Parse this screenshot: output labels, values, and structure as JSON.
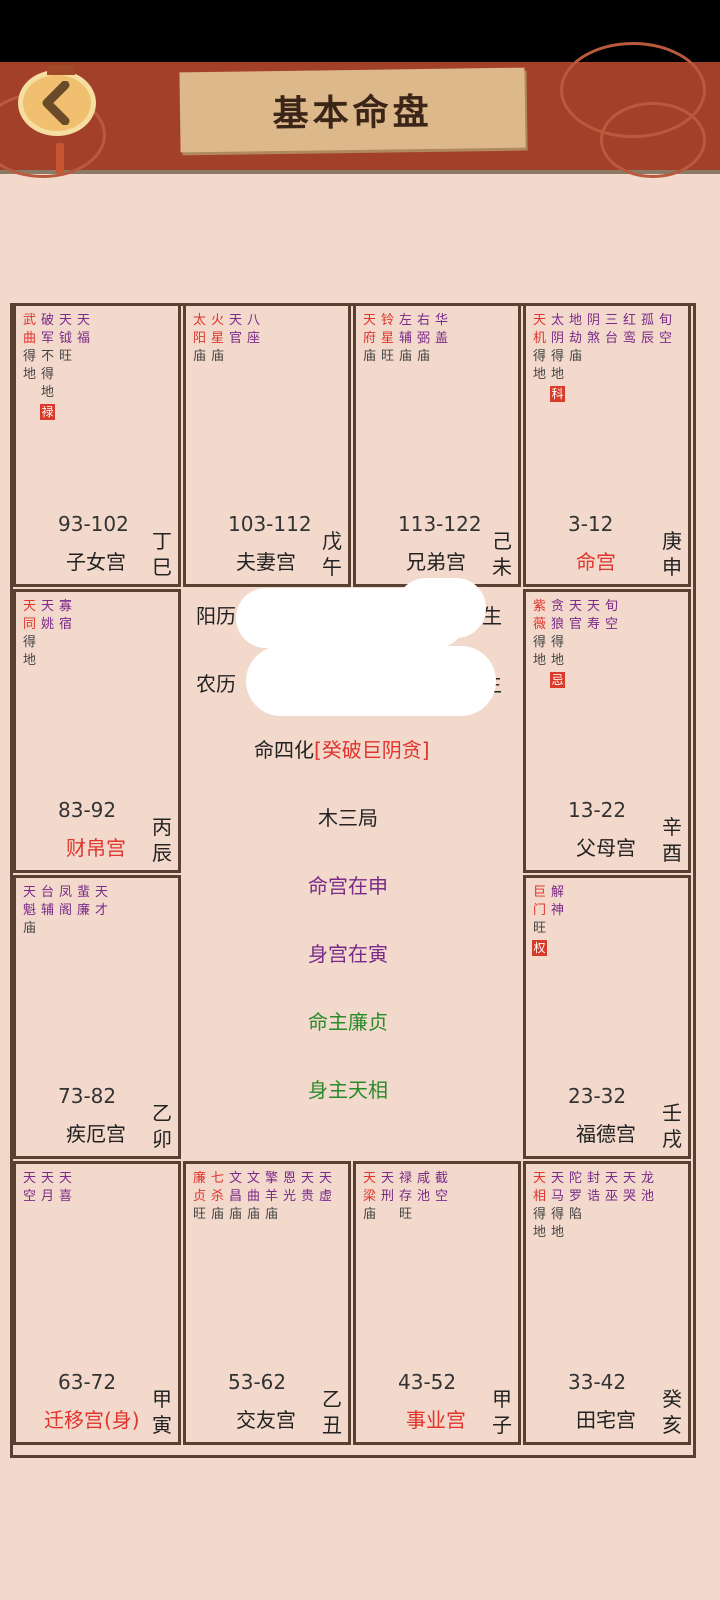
{
  "header": {
    "title": "基本命盘",
    "back_icon": "chevron-left-icon"
  },
  "palaces": [
    {
      "id": "zinv",
      "pos": [
        0,
        0
      ],
      "ages": "93-102",
      "name": "子女宫",
      "gan": "丁",
      "zhi": "巳",
      "highlight": false,
      "stars": [
        {
          "n": "武曲",
          "c": "red",
          "s": [
            "得",
            "地"
          ]
        },
        {
          "n": "破军",
          "c": "purple",
          "s": [
            "不",
            "得",
            "地"
          ],
          "hua": "禄"
        },
        {
          "n": "天钺",
          "c": "purple",
          "s": [
            "旺"
          ]
        },
        {
          "n": "天福",
          "c": "purple",
          "s": []
        }
      ]
    },
    {
      "id": "fuqi",
      "pos": [
        1,
        0
      ],
      "ages": "103-112",
      "name": "夫妻宫",
      "gan": "戊",
      "zhi": "午",
      "highlight": false,
      "stars": [
        {
          "n": "太阳",
          "c": "red",
          "s": [
            "庙"
          ]
        },
        {
          "n": "火星",
          "c": "red",
          "s": [
            "庙"
          ]
        },
        {
          "n": "天官",
          "c": "purple",
          "s": []
        },
        {
          "n": "八座",
          "c": "purple",
          "s": []
        }
      ]
    },
    {
      "id": "xiongdi",
      "pos": [
        2,
        0
      ],
      "ages": "113-122",
      "name": "兄弟宫",
      "gan": "己",
      "zhi": "未",
      "highlight": false,
      "stars": [
        {
          "n": "天府",
          "c": "red",
          "s": [
            "庙"
          ]
        },
        {
          "n": "铃星",
          "c": "red",
          "s": [
            "旺"
          ]
        },
        {
          "n": "左辅",
          "c": "purple",
          "s": [
            "庙"
          ]
        },
        {
          "n": "右弼",
          "c": "purple",
          "s": [
            "庙"
          ]
        },
        {
          "n": "华盖",
          "c": "purple",
          "s": []
        }
      ]
    },
    {
      "id": "ming",
      "pos": [
        3,
        0
      ],
      "ages": "3-12",
      "name": "命宫",
      "gan": "庚",
      "zhi": "申",
      "highlight": true,
      "stars": [
        {
          "n": "天机",
          "c": "red",
          "s": [
            "得",
            "地"
          ]
        },
        {
          "n": "太阴",
          "c": "purple",
          "s": [
            "得",
            "地"
          ],
          "hua": "科"
        },
        {
          "n": "地劫",
          "c": "purple",
          "s": [
            "庙"
          ]
        },
        {
          "n": "阴煞",
          "c": "purple",
          "s": []
        },
        {
          "n": "三台",
          "c": "purple",
          "s": []
        },
        {
          "n": "红鸾",
          "c": "purple",
          "s": []
        },
        {
          "n": "孤辰",
          "c": "purple",
          "s": []
        },
        {
          "n": "旬空",
          "c": "purple",
          "s": []
        }
      ]
    },
    {
      "id": "caibo",
      "pos": [
        0,
        1
      ],
      "ages": "83-92",
      "name": "财帛宫",
      "gan": "丙",
      "zhi": "辰",
      "highlight": true,
      "stars": [
        {
          "n": "天同",
          "c": "red",
          "s": [
            "得",
            "地"
          ]
        },
        {
          "n": "天姚",
          "c": "purple",
          "s": []
        },
        {
          "n": "寡宿",
          "c": "purple",
          "s": []
        }
      ]
    },
    {
      "id": "fumu",
      "pos": [
        3,
        1
      ],
      "ages": "13-22",
      "name": "父母宫",
      "gan": "辛",
      "zhi": "酉",
      "highlight": false,
      "stars": [
        {
          "n": "紫薇",
          "c": "red",
          "s": [
            "得",
            "地"
          ]
        },
        {
          "n": "贪狼",
          "c": "purple",
          "s": [
            "得",
            "地"
          ],
          "hua": "忌"
        },
        {
          "n": "天官",
          "c": "purple",
          "s": []
        },
        {
          "n": "天寿",
          "c": "purple",
          "s": []
        },
        {
          "n": "旬空",
          "c": "purple",
          "s": []
        }
      ]
    },
    {
      "id": "jie",
      "pos": [
        0,
        2
      ],
      "ages": "73-82",
      "name": "疾厄宫",
      "gan": "乙",
      "zhi": "卯",
      "highlight": false,
      "stars": [
        {
          "n": "天魁",
          "c": "purple",
          "s": [
            "庙"
          ]
        },
        {
          "n": "台辅",
          "c": "purple",
          "s": []
        },
        {
          "n": "凤阁",
          "c": "purple",
          "s": []
        },
        {
          "n": "蜚廉",
          "c": "purple",
          "s": []
        },
        {
          "n": "天才",
          "c": "purple",
          "s": []
        }
      ]
    },
    {
      "id": "fude",
      "pos": [
        3,
        2
      ],
      "ages": "23-32",
      "name": "福德宫",
      "gan": "壬",
      "zhi": "戌",
      "highlight": false,
      "stars": [
        {
          "n": "巨门",
          "c": "red",
          "s": [
            "旺"
          ],
          "hua": "权"
        },
        {
          "n": "解神",
          "c": "purple",
          "s": []
        }
      ]
    },
    {
      "id": "qianyi",
      "pos": [
        0,
        3
      ],
      "ages": "63-72",
      "name": "迁移宫(身)",
      "gan": "甲",
      "zhi": "寅",
      "highlight": true,
      "stars": [
        {
          "n": "天空",
          "c": "purple",
          "s": []
        },
        {
          "n": "天月",
          "c": "purple",
          "s": []
        },
        {
          "n": "天喜",
          "c": "purple",
          "s": []
        }
      ]
    },
    {
      "id": "jiaoyou",
      "pos": [
        1,
        3
      ],
      "ages": "53-62",
      "name": "交友宫",
      "gan": "乙",
      "zhi": "丑",
      "highlight": false,
      "stars": [
        {
          "n": "廉贞",
          "c": "red",
          "s": [
            "旺"
          ]
        },
        {
          "n": "七杀",
          "c": "red",
          "s": [
            "庙"
          ]
        },
        {
          "n": "文昌",
          "c": "purple",
          "s": [
            "庙"
          ]
        },
        {
          "n": "文曲",
          "c": "purple",
          "s": [
            "庙"
          ]
        },
        {
          "n": "擎羊",
          "c": "purple",
          "s": [
            "庙"
          ]
        },
        {
          "n": "恩光",
          "c": "purple",
          "s": []
        },
        {
          "n": "天贵",
          "c": "purple",
          "s": []
        },
        {
          "n": "天虚",
          "c": "purple",
          "s": []
        }
      ]
    },
    {
      "id": "shiye",
      "pos": [
        2,
        3
      ],
      "ages": "43-52",
      "name": "事业宫",
      "gan": "甲",
      "zhi": "子",
      "highlight": true,
      "stars": [
        {
          "n": "天梁",
          "c": "red",
          "s": [
            "庙"
          ]
        },
        {
          "n": "天刑",
          "c": "purple",
          "s": []
        },
        {
          "n": "禄存",
          "c": "purple",
          "s": [
            "旺"
          ]
        },
        {
          "n": "咸池",
          "c": "purple",
          "s": []
        },
        {
          "n": "截空",
          "c": "purple",
          "s": []
        }
      ]
    },
    {
      "id": "tianzhai",
      "pos": [
        3,
        3
      ],
      "ages": "33-42",
      "name": "田宅宫",
      "gan": "癸",
      "zhi": "亥",
      "highlight": false,
      "stars": [
        {
          "n": "天相",
          "c": "red",
          "s": [
            "得",
            "地"
          ]
        },
        {
          "n": "天马",
          "c": "purple",
          "s": [
            "得",
            "地"
          ]
        },
        {
          "n": "陀罗",
          "c": "purple",
          "s": [
            "陷"
          ]
        },
        {
          "n": "封诰",
          "c": "purple",
          "s": []
        },
        {
          "n": "天巫",
          "c": "purple",
          "s": []
        },
        {
          "n": "天哭",
          "c": "purple",
          "s": []
        },
        {
          "n": "龙池",
          "c": "purple",
          "s": []
        }
      ]
    }
  ],
  "center": {
    "solar_label": "阳历",
    "solar_tail": "时生",
    "lunar_label": "农历",
    "lunar_tail": "生",
    "sihua_label": "命四化",
    "sihua_value": "[癸破巨阴贪]",
    "ju": "木三局",
    "minggong": "命宫在申",
    "shengong": "身宫在寅",
    "mingzhu": "命主廉贞",
    "shenzhu": "身主天相"
  },
  "colors": {
    "red": "#e0342c",
    "purple": "#7a2a88",
    "green": "#2a8a2a",
    "header": "#a3402a",
    "bg": "#f2d9cc"
  }
}
